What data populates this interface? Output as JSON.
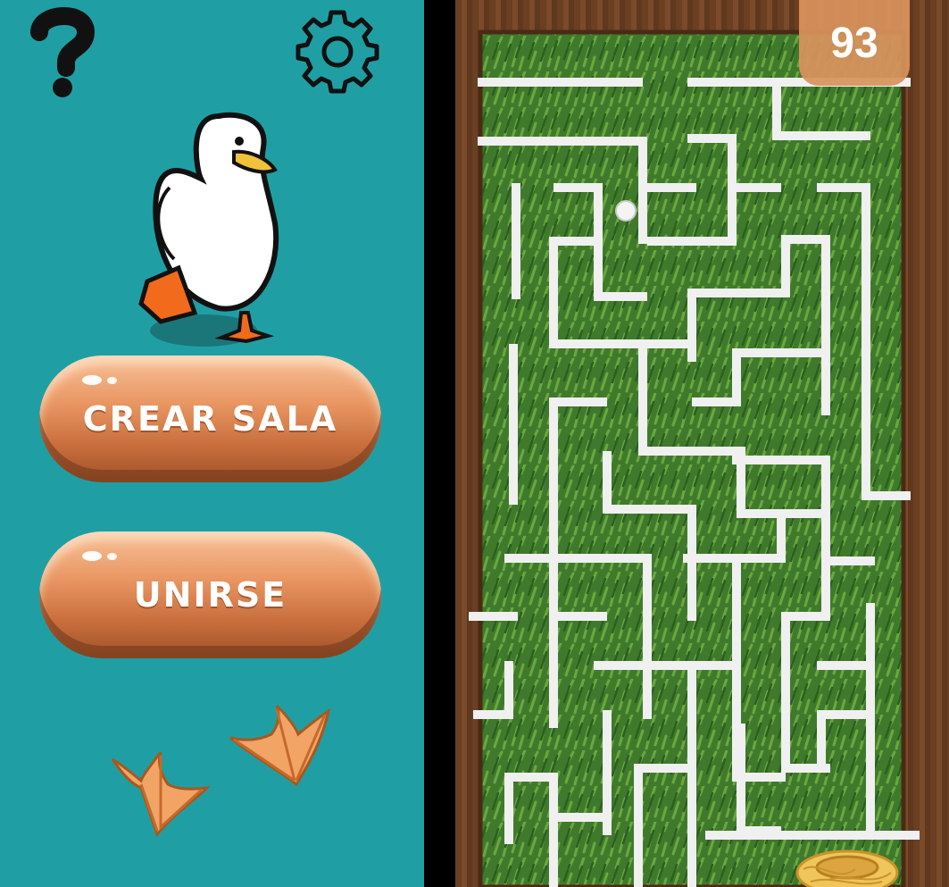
{
  "menu": {
    "help_label": "?",
    "buttons": [
      {
        "label": "CREAR SALA"
      },
      {
        "label": "UNIRSE"
      }
    ]
  },
  "icons": {
    "help": "question-mark-icon",
    "settings": "gear-icon",
    "mascot": "duck-icon",
    "footprints": "duck-footprint-icon",
    "goal": "nest-icon",
    "ball": "ball-icon"
  },
  "game": {
    "score": "93"
  },
  "colors": {
    "left_panel": "#1f9fa4",
    "button": "#e99662",
    "grass": "#3f7a2c",
    "wall": "#f2f2f2",
    "score_badge": "#d8925c"
  }
}
